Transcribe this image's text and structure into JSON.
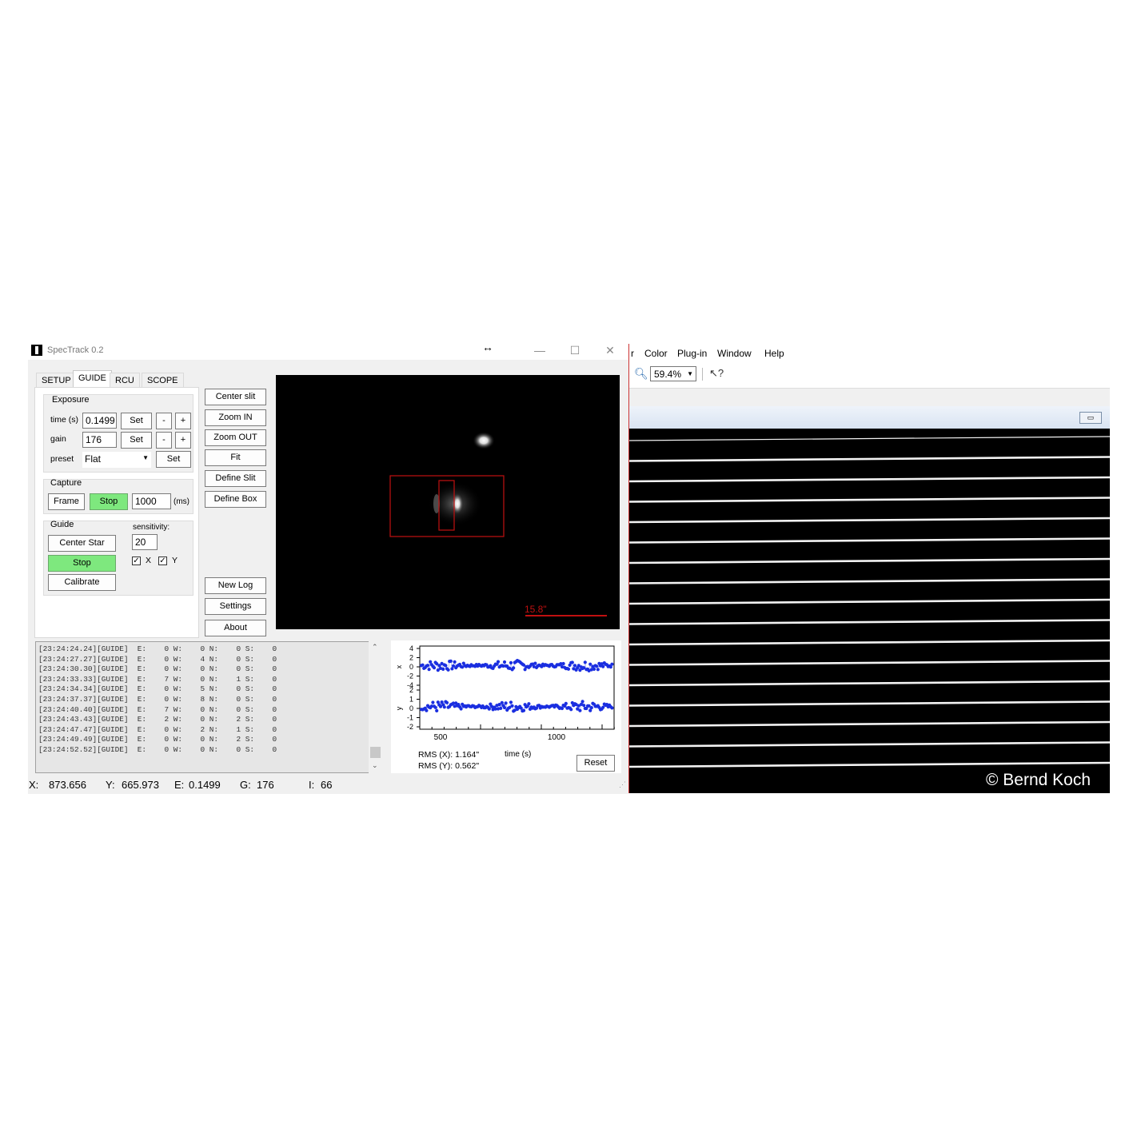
{
  "spectrack": {
    "title": "SpecTrack 0.2",
    "tabs": [
      "SETUP",
      "GUIDE",
      "RCU",
      "SCOPE"
    ],
    "exposure": {
      "group_label": "Exposure",
      "time_label": "time (s)",
      "time_value": "0.1499",
      "gain_label": "gain",
      "gain_value": "176",
      "preset_label": "preset",
      "preset_value": "Flat",
      "set_label": "Set",
      "minus_label": "-",
      "plus_label": "+"
    },
    "capture": {
      "group_label": "Capture",
      "frame_label": "Frame",
      "stop_label": "Stop",
      "interval_value": "1000",
      "interval_unit": "(ms)"
    },
    "guide": {
      "group_label": "Guide",
      "center_star_label": "Center Star",
      "stop_label": "Stop",
      "calibrate_label": "Calibrate",
      "sensitivity_label": "sensitivity:",
      "sensitivity_value": "20",
      "x_label": "X",
      "y_label": "Y",
      "x_checked": true,
      "y_checked": true
    },
    "side_buttons": {
      "center_slit": "Center slit",
      "zoom_in": "Zoom IN",
      "zoom_out": "Zoom OUT",
      "fit": "Fit",
      "define_slit": "Define Slit",
      "define_box": "Define Box",
      "new_log": "New Log",
      "settings": "Settings",
      "about": "About"
    },
    "camera": {
      "scale_label": "15.8\""
    },
    "log_lines": [
      "[23:24:24.24][GUIDE]  E:    0 W:    0 N:    0 S:    0",
      "[23:24:27.27][GUIDE]  E:    0 W:    4 N:    0 S:    0",
      "[23:24:30.30][GUIDE]  E:    0 W:    0 N:    0 S:    0",
      "[23:24:33.33][GUIDE]  E:    7 W:    0 N:    1 S:    0",
      "[23:24:34.34][GUIDE]  E:    0 W:    5 N:    0 S:    0",
      "[23:24:37.37][GUIDE]  E:    0 W:    8 N:    0 S:    0",
      "[23:24:40.40][GUIDE]  E:    7 W:    0 N:    0 S:    0",
      "[23:24:43.43][GUIDE]  E:    2 W:    0 N:    2 S:    0",
      "[23:24:47.47][GUIDE]  E:    0 W:    2 N:    1 S:    0",
      "[23:24:49.49][GUIDE]  E:    0 W:    0 N:    2 S:    0",
      "[23:24:52.52][GUIDE]  E:    0 W:    0 N:    0 S:    0"
    ],
    "plot": {
      "x_ticks": [
        "500",
        "1000"
      ],
      "x_label": "time (s)",
      "x_axis_short": "x",
      "y_axis_short": "y",
      "x_yticks": [
        "4",
        "2",
        "0",
        "-2",
        "-4"
      ],
      "y_yticks": [
        "2",
        "1",
        "0",
        "-1",
        "-2"
      ],
      "rms_x": "RMS (X): 1.164\"",
      "rms_y": "RMS (Y): 0.562\"",
      "reset_label": "Reset",
      "point_color": "#1a2ee0"
    },
    "status": {
      "x_label": "X:",
      "x_value": "873.656",
      "y_label": "Y:",
      "y_value": "665.973",
      "e_label": "E:",
      "e_value": "0.1499",
      "g_label": "G:",
      "g_value": "176",
      "i_label": "I:",
      "i_value": "66"
    }
  },
  "right_app": {
    "menu": [
      "r",
      "Color",
      "Plug-in",
      "Window",
      "Help"
    ],
    "zoom_value": "59.4%",
    "copyright": "© Bernd Koch"
  },
  "chart_data": [
    {
      "type": "scatter",
      "panel": "x",
      "ylim": [
        -4,
        4
      ],
      "x_range": [
        350,
        1250
      ],
      "series": [
        {
          "values_mean": 0.3,
          "values_spread": 1.2
        }
      ]
    },
    {
      "type": "scatter",
      "panel": "y",
      "ylim": [
        -2,
        2
      ],
      "x_range": [
        350,
        1250
      ],
      "series": [
        {
          "values_mean": 0.2,
          "values_spread": 0.6
        }
      ]
    }
  ]
}
